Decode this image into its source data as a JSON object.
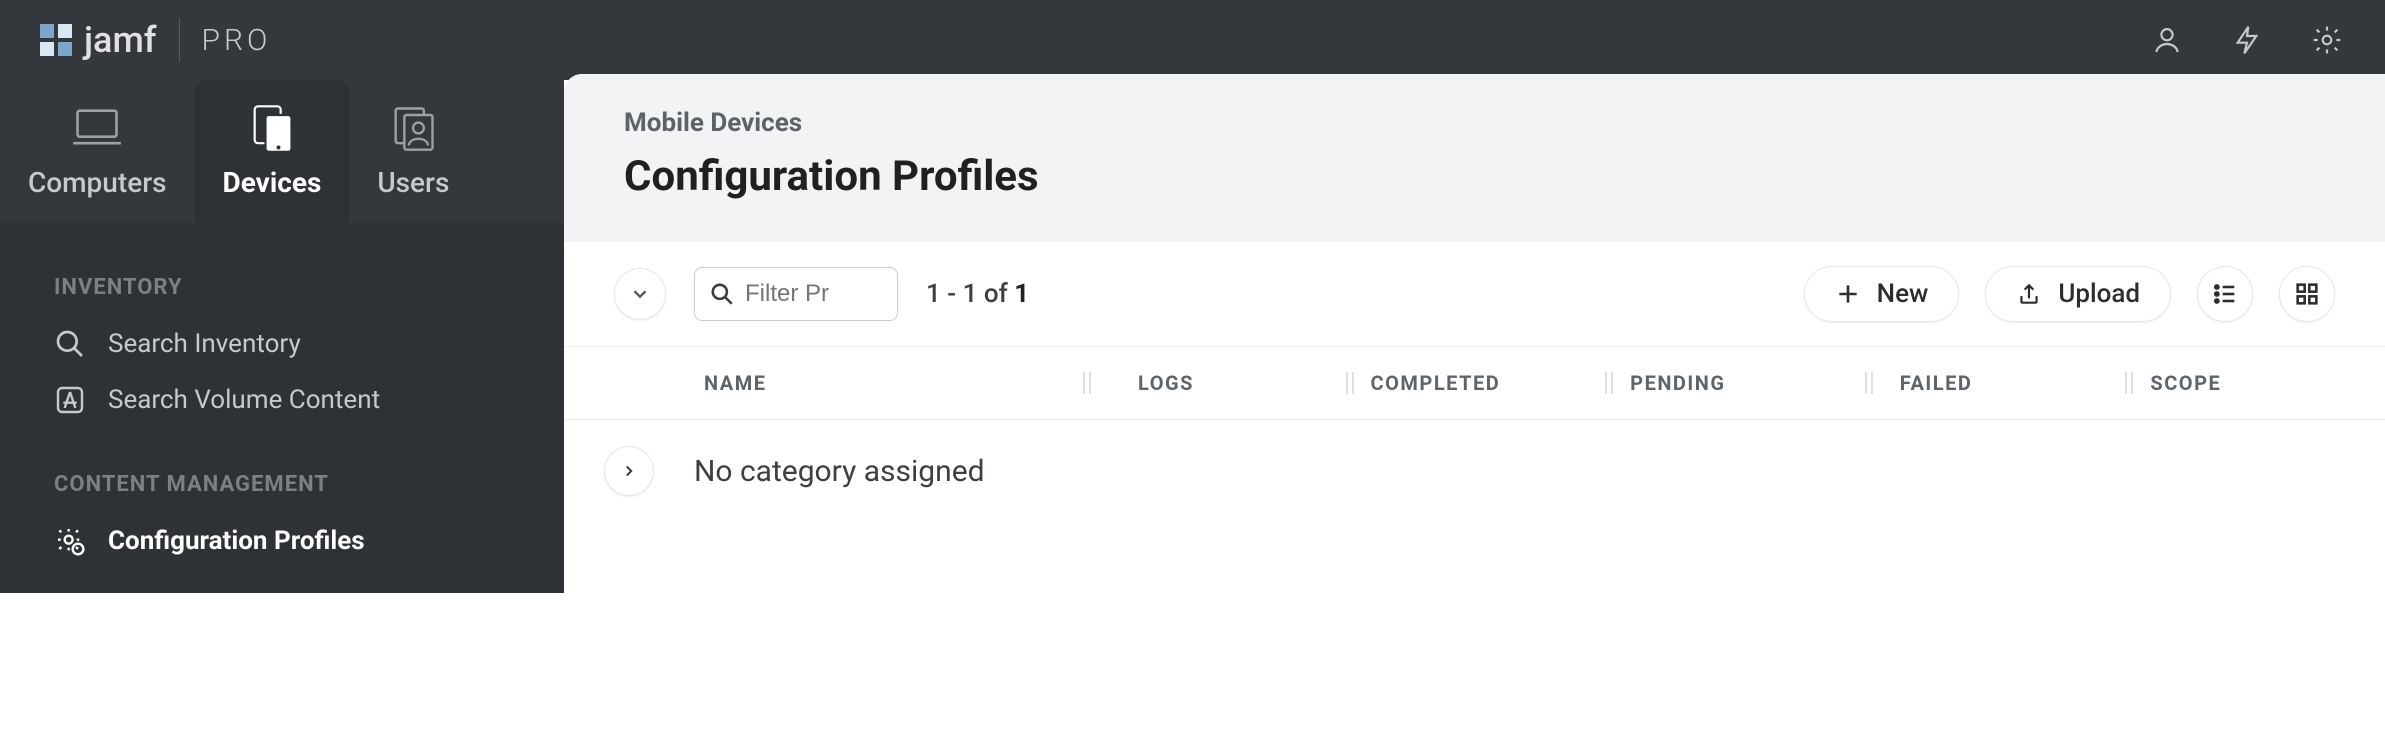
{
  "brand": {
    "jamf": "jamf",
    "pro": "PRO"
  },
  "topbar": {
    "icons": [
      "user",
      "bolt",
      "gear"
    ]
  },
  "tabs": [
    {
      "id": "computers",
      "label": "Computers"
    },
    {
      "id": "devices",
      "label": "Devices",
      "active": true
    },
    {
      "id": "users",
      "label": "Users"
    }
  ],
  "sidebar": {
    "sections": [
      {
        "heading": "INVENTORY",
        "items": [
          {
            "id": "search-inventory",
            "label": "Search Inventory",
            "icon": "search"
          },
          {
            "id": "search-volume",
            "label": "Search Volume Content",
            "icon": "appstore"
          }
        ]
      },
      {
        "heading": "CONTENT MANAGEMENT",
        "items": [
          {
            "id": "config-profiles",
            "label": "Configuration Profiles",
            "icon": "gear-badge",
            "active": true
          }
        ]
      }
    ]
  },
  "main": {
    "breadcrumb": "Mobile Devices",
    "title": "Configuration Profiles",
    "filter_placeholder": "Filter Pr",
    "count": {
      "from": "1",
      "to": "1",
      "total": "1",
      "sep": "-",
      "of": "of"
    },
    "actions": {
      "new": "New",
      "upload": "Upload"
    },
    "table": {
      "columns": [
        "NAME",
        "LOGS",
        "COMPLETED",
        "PENDING",
        "FAILED",
        "SCOPE"
      ]
    },
    "rows": [
      {
        "label": "No category assigned"
      }
    ]
  }
}
